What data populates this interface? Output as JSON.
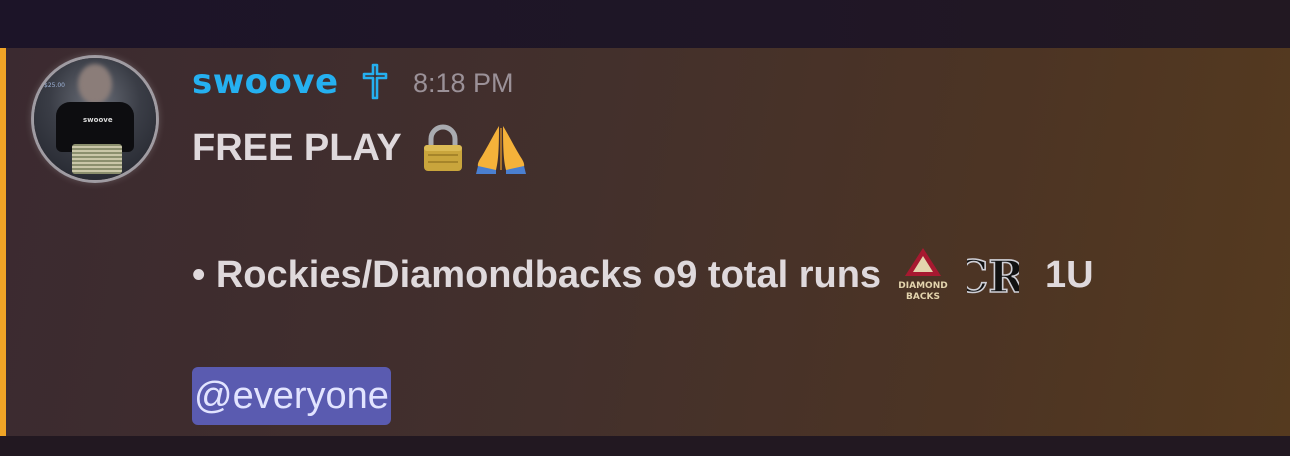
{
  "message": {
    "author": {
      "username": "swoove",
      "role_icon": "cross-icon",
      "avatar_shirt_text": "swoove",
      "avatar_screen_text": "$25.00",
      "name_color": "#25b0f0"
    },
    "timestamp": "8:18 PM",
    "line1_text": "FREE PLAY",
    "line1_emojis": [
      "lock-icon",
      "folded-hands-icon"
    ],
    "line2_text": "• Rockies/Diamondbacks o9 total runs",
    "line2_emojis": [
      "diamondbacks-logo-icon",
      "rockies-logo-icon"
    ],
    "dbacks_logo_text_1": "DIAMOND",
    "dbacks_logo_text_2": "BACKS",
    "rockies_logo_text": "CR",
    "units": "1U",
    "mention": "@everyone",
    "colors": {
      "mention_bar": "#f0a426",
      "mention_bg": "#5a5bb0",
      "text": "#dfd9dc",
      "timestamp": "#9b9198"
    }
  }
}
